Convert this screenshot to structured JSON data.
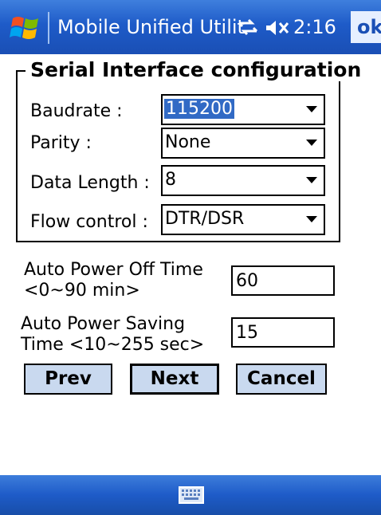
{
  "titlebar": {
    "title": "Mobile Unified Utilit",
    "time": "2:16",
    "ok_label": "ok",
    "icons": [
      "windows-flag-icon",
      "connectivity-icon",
      "volume-muted-icon"
    ]
  },
  "serial": {
    "group_title": "Serial Interface configuration",
    "baudrate": {
      "label": "Baudrate :",
      "value": "115200"
    },
    "parity": {
      "label": "Parity :",
      "value": "None"
    },
    "data_length": {
      "label": "Data Length :",
      "value": "8"
    },
    "flow_control": {
      "label": "Flow control :",
      "value": "DTR/DSR"
    }
  },
  "power": {
    "off_label_1": "Auto Power Off Time",
    "off_label_2": "<0~90 min>",
    "off_value": "60",
    "saving_label_1": "Auto Power Saving",
    "saving_label_2": "Time <10~255 sec>",
    "saving_value": "15"
  },
  "buttons": {
    "prev": "Prev",
    "next": "Next",
    "cancel": "Cancel"
  },
  "menubar": {
    "icon": "keyboard-icon"
  },
  "colors": {
    "titlebar": "#1e5bc8",
    "selection": "#316ac5",
    "button_face": "#c9d9ef"
  }
}
